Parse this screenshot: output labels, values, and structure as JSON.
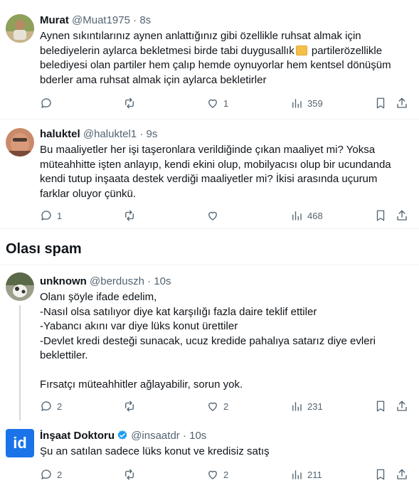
{
  "tweets": [
    {
      "display_name": "Murat",
      "handle": "@Muat1975",
      "dot": "·",
      "time": "8s",
      "lines": [
        "Aynen sıkıntılarınız aynen anlattığınız gibi özellikle ruhsat almak için",
        "belediyelerin aylarca bekletmesi birde tabi duygusallık",
        "partilerözellikle",
        "belediyesi olan partiler hem çalıp hemde oynuyorlar hem kentsel dönüşüm",
        "bderler ama ruhsat almak için aylarca bekletirler"
      ],
      "actions": {
        "replies": "",
        "reposts": "",
        "likes": "1",
        "views": "359"
      }
    },
    {
      "display_name": "haluktel",
      "handle": "@haluktel1",
      "dot": "·",
      "time": "9s",
      "lines": [
        "Bu maaliyetler her işi taşeronlara verildiğinde çıkan maaliyet mi? Yoksa",
        "müteahhitte işten anlayıp, kendi ekini olup, mobilyacısı olup bir ucundanda",
        "kendi tutup inşaata destek verdiği maaliyetler mi? İkisi arasında uçurum",
        "farklar oluyor çünkü."
      ],
      "actions": {
        "replies": "1",
        "reposts": "",
        "likes": "",
        "views": "468"
      }
    }
  ],
  "section": {
    "title": "Olası spam"
  },
  "spam_tweets": [
    {
      "display_name": "unknown",
      "handle": "@berduszh",
      "dot": "·",
      "time": "10s",
      "lines": [
        "Olanı şöyle ifade edelim,",
        "-Nasıl olsa satılıyor diye kat karşılığı fazla daire teklif ettiler",
        "-Yabancı akını var diye lüks konut ürettiler",
        "-Devlet kredi desteği sunacak, ucuz kredide pahalıya satarız diye evleri",
        "beklettiler.",
        "",
        "Fırsatçı müteahhitler ağlayabilir, sorun yok."
      ],
      "actions": {
        "replies": "2",
        "reposts": "",
        "likes": "2",
        "views": "231"
      }
    },
    {
      "display_name": "İnşaat Doktoru",
      "handle": "@insaatdr",
      "dot": "·",
      "time": "10s",
      "avatar_text": "id",
      "lines": [
        "Şu an satılan sadece lüks konut ve kredisiz satış"
      ],
      "actions": {
        "replies": "2",
        "reposts": "",
        "likes": "2",
        "views": "211"
      }
    }
  ],
  "colors": {
    "text": "#0f1419",
    "secondary": "#536471",
    "divider": "#eff3f4",
    "verified": "#1d9bf0",
    "brand_id": "#1a73e8"
  },
  "icons": [
    "reply-icon",
    "repost-icon",
    "like-icon",
    "views-icon",
    "bookmark-icon",
    "share-icon",
    "verified-badge-icon"
  ]
}
